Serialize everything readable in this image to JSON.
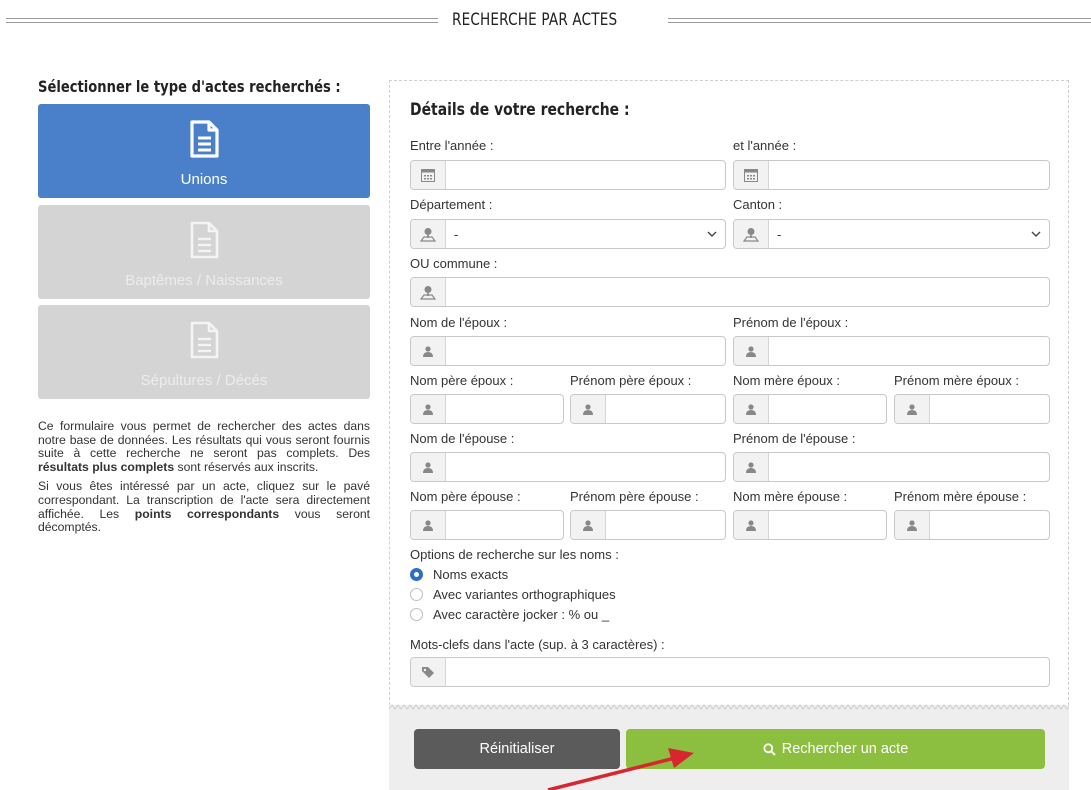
{
  "header": {
    "title": "RECHERCHE PAR ACTES"
  },
  "left": {
    "title": "Sélectionner le type d'actes recherchés :",
    "types": [
      {
        "label": "Unions",
        "selected": true,
        "icon": "document-icon"
      },
      {
        "label": "Baptêmes / Naissances",
        "selected": false,
        "icon": "document-icon"
      },
      {
        "label": "Sépultures / Décés",
        "selected": false,
        "icon": "document-icon"
      }
    ],
    "desc1_a": "Ce formulaire vous permet de rechercher des actes dans notre base de données. Les résultats qui vous seront fournis suite à cette recherche ne seront pas complets. Des ",
    "desc1_b": "résultats plus complets",
    "desc1_c": " sont réservés aux inscrits.",
    "desc2_a": "Si vous êtes intéressé par un acte, cliquez sur le pavé correspondant. La transcription de l'acte sera directement affichée. Les ",
    "desc2_b": "points correspondants",
    "desc2_c": " vous seront décomptés."
  },
  "form": {
    "title": "Détails de votre recherche :",
    "labels": {
      "year_from": "Entre l'année :",
      "year_to": "et l'année :",
      "departement": "Département :",
      "canton": "Canton :",
      "commune": "OU commune :",
      "nom_epoux": "Nom de l'époux :",
      "prenom_epoux": "Prénom de l'époux :",
      "nom_pere_epoux": "Nom père époux :",
      "prenom_pere_epoux": "Prénom père époux :",
      "nom_mere_epoux": "Nom mère époux :",
      "prenom_mere_epoux": "Prénom mère époux :",
      "nom_epouse": "Nom de l'épouse :",
      "prenom_epouse": "Prénom de l'épouse :",
      "nom_pere_epouse": "Nom père épouse :",
      "prenom_pere_epouse": "Prénom père épouse :",
      "nom_mere_epouse": "Nom mère épouse :",
      "prenom_mere_epouse": "Prénom mère épouse :",
      "options": "Options de recherche sur les noms :",
      "keywords": "Mots-clefs dans l'acte (sup. à 3 caractères) :"
    },
    "departement_value": "-",
    "canton_value": "-",
    "name_options": [
      {
        "label": "Noms exacts",
        "selected": true
      },
      {
        "label": "Avec variantes orthographiques",
        "selected": false
      },
      {
        "label": "Avec caractère jocker : % ou _",
        "selected": false
      }
    ],
    "reset_label": "Réinitialiser",
    "search_label": "Rechercher un acte"
  },
  "colors": {
    "accent_blue": "#4a7fc9",
    "search_green": "#8cbf3f",
    "reset_gray": "#5b5b5b",
    "arrow_red": "#d8262f"
  }
}
